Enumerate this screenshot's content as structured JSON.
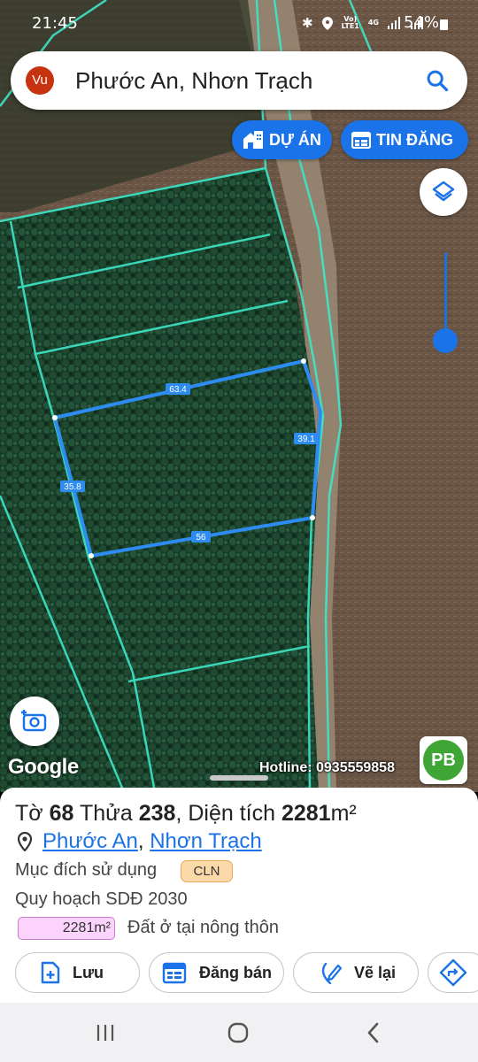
{
  "status_bar": {
    "time": "21:45",
    "network_label_top": "Vo)",
    "network_label_bottom": "LTE1",
    "network_type": "4G",
    "battery": "54%"
  },
  "search": {
    "avatar_initials": "Vu",
    "query": "Phước An, Nhơn Trạch"
  },
  "chips": {
    "project": "DỰ ÁN",
    "listing": "TIN ĐĂNG"
  },
  "map": {
    "parcel_edges": [
      "63.4",
      "39.1",
      "56",
      "35.8"
    ],
    "watermark": "Google",
    "hotline": "Hotline: 0935559858",
    "logo_text": "PB"
  },
  "parcel": {
    "sheet_label": "Tờ",
    "sheet_no": "68",
    "lot_label": "Thửa",
    "lot_no": "238",
    "area_label": "Diện tích",
    "area": "2281",
    "area_unit": "m²",
    "ward": "Phước An",
    "district": "Nhơn Trạch",
    "location_separator": ", ",
    "purpose_label": "Mục đích sử dụng",
    "purpose_code": "CLN",
    "plan_label": "Quy hoạch SDĐ 2030",
    "plan_area": "2281m²",
    "plan_landuse": "Đất ở tại nông thôn"
  },
  "actions": {
    "save": "Lưu",
    "post": "Đăng bán",
    "redraw": "Vẽ lại"
  },
  "colors": {
    "accent": "#1a73e8",
    "parcel_line": "#2e8bf0",
    "cadastral_line": "#3ee6c8",
    "purpose_badge": "#fbd9a9",
    "plan_badge": "#fbd3fc"
  }
}
